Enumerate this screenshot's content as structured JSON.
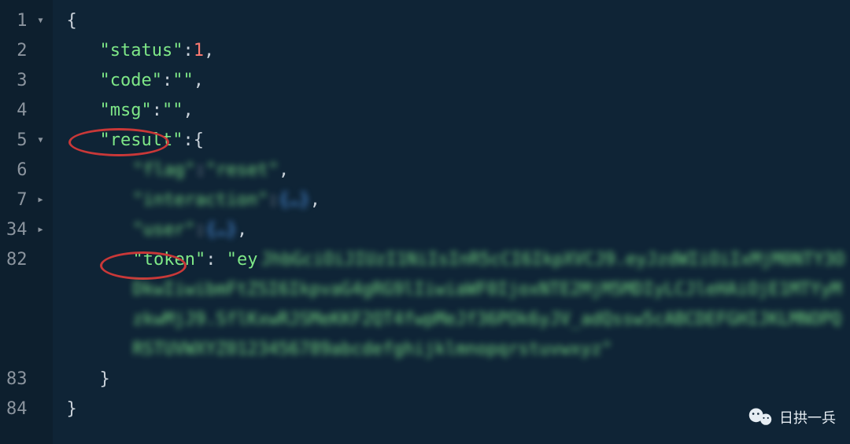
{
  "gutter": {
    "lines": [
      {
        "num": "1",
        "fold": "▼"
      },
      {
        "num": "2",
        "fold": ""
      },
      {
        "num": "3",
        "fold": ""
      },
      {
        "num": "4",
        "fold": ""
      },
      {
        "num": "5",
        "fold": "▼"
      },
      {
        "num": "6",
        "fold": ""
      },
      {
        "num": "7",
        "fold": "▶"
      },
      {
        "num": "34",
        "fold": "▶"
      },
      {
        "num": "82",
        "fold": ""
      },
      {
        "num": "",
        "fold": ""
      },
      {
        "num": "",
        "fold": ""
      },
      {
        "num": "",
        "fold": ""
      },
      {
        "num": "83",
        "fold": ""
      },
      {
        "num": "84",
        "fold": ""
      }
    ]
  },
  "json": {
    "line1": {
      "brace": "{"
    },
    "line2": {
      "key": "\"status\"",
      "colon": ": ",
      "value": "1",
      "comma": ","
    },
    "line3": {
      "key": "\"code\"",
      "colon": ": ",
      "value": "\"\"",
      "comma": ","
    },
    "line4": {
      "key": "\"msg\"",
      "colon": ": ",
      "value": "\"\"",
      "comma": ","
    },
    "line5": {
      "key": "\"result\"",
      "colon": ": ",
      "brace": "{"
    },
    "line6": {
      "key": "\"flag\"",
      "colon": ": ",
      "value": "\"reset\"",
      "comma": ","
    },
    "line7": {
      "key": "\"interaction\"",
      "colon": ": ",
      "value": "{…}",
      "comma": ","
    },
    "line34": {
      "key": "\"user\"",
      "colon": ": ",
      "value": "{…}",
      "comma": ","
    },
    "line82": {
      "key": "\"token\"",
      "colon": ": ",
      "value_start": "\"ey",
      "value_blur": "JhbGciOiJIUzI1NiIsInR5cCI6IkpXVCJ9.eyJzdWIiOiIxMjM0NTY3ODkwIiwibmFtZSI6IkpvaG4gRG9lIiwiaWF0IjoxNTE2MjM5MDIyLCJleHAiOjE1MTYyMzkwMjJ9.SflKxwRJSMeKKF2QT4fwpMeJf36POk6yJV_adQssw5cABCDEFGHIJKLMNOPQRSTUVWXYZ0123456789abcdefghijklmnopqrstuvwxyz\""
    },
    "line83": {
      "brace": "}"
    },
    "line84": {
      "brace": "}"
    }
  },
  "highlights": {
    "result_key": "result",
    "token_key": "token"
  },
  "watermark": {
    "text": "日拱一兵"
  }
}
